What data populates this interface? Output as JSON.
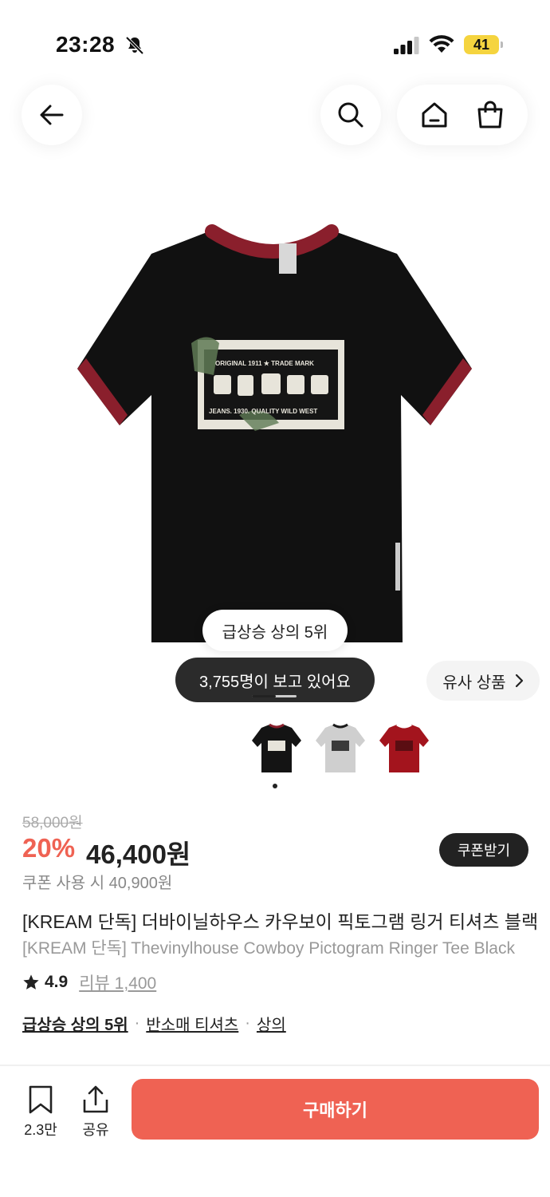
{
  "status_bar": {
    "time": "23:28",
    "battery": "41",
    "icons": [
      "bell-slash-icon",
      "signal-icon",
      "wifi-icon",
      "battery-icon"
    ]
  },
  "nav": {
    "icons": [
      "arrow-left-icon",
      "search-icon",
      "home-icon",
      "shopping-bag-icon"
    ]
  },
  "gallery": {
    "rank_chip": "급상승 상의 5위",
    "viewers_chip": "3,755명이 보고 있어요",
    "similar_label": "유사 상품",
    "thumbnails": [
      {
        "color": "black",
        "shirt": "#141414",
        "trim": "#8a1f2c"
      },
      {
        "color": "gray",
        "shirt": "#cfcfcf",
        "trim": "#1a1a1a"
      },
      {
        "color": "red",
        "shirt": "#a3141d",
        "trim": "#ffffff"
      }
    ],
    "print_text_top": "ORIGINAL 1911 ★ TRADE MARK",
    "print_text_bottom": "JEANS. 1930. QUALITY WILD WEST"
  },
  "price": {
    "original": "58,000원",
    "discount": "20%",
    "current": "46,400원",
    "coupon_price": "쿠폰 사용 시 40,900원",
    "coupon_button": "쿠폰받기"
  },
  "product": {
    "title_ko": "[KREAM 단독] 더바이닐하우스 카우보이 픽토그램 링거 티셔츠 블랙",
    "title_en": "[KREAM 단독] Thevinylhouse Cowboy Pictogram Ringer Tee Black"
  },
  "rating": {
    "score": "4.9",
    "review_label": "리뷰 1,400"
  },
  "tags": [
    "급상승 상의 5위",
    "반소매 티셔츠",
    "상의"
  ],
  "tag_separator": "·",
  "bottom": {
    "save_count": "2.3만",
    "share_label": "공유",
    "buy_label": "구매하기"
  },
  "colors": {
    "accent": "#ef6253",
    "dark": "#222222",
    "muted": "#999999"
  }
}
